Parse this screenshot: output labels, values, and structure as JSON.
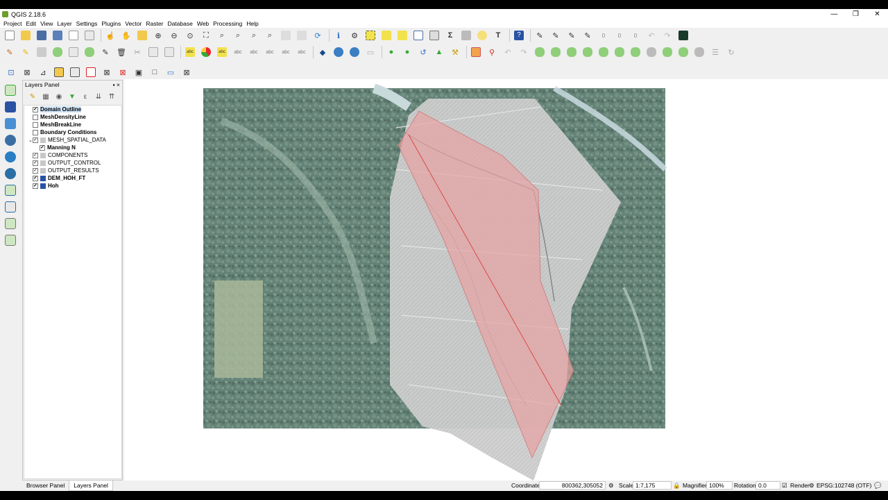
{
  "window": {
    "title": "QGIS 2.18.6",
    "controls": [
      "—",
      "❐",
      "✕"
    ]
  },
  "menu": [
    "Project",
    "Edit",
    "View",
    "Layer",
    "Settings",
    "Plugins",
    "Vector",
    "Raster",
    "Database",
    "Web",
    "Processing",
    "Help"
  ],
  "layers_panel": {
    "title": "Layers Panel",
    "header_controls": "▪ ×",
    "layers": [
      {
        "label": "Domain Outline",
        "checked": true,
        "bold": true,
        "selected": true,
        "indent": 0,
        "expander": ""
      },
      {
        "label": "MeshDensityLine",
        "checked": false,
        "bold": true,
        "indent": 0,
        "expander": ""
      },
      {
        "label": "MeshBreakLine",
        "checked": false,
        "bold": true,
        "indent": 0,
        "expander": ""
      },
      {
        "label": "Boundary Conditions",
        "checked": false,
        "bold": true,
        "indent": 0,
        "expander": ""
      },
      {
        "label": "MESH_SPATIAL_DATA",
        "checked": true,
        "bold": false,
        "indent": 0,
        "expander": "⌄",
        "group": true
      },
      {
        "label": "Manning N",
        "checked": true,
        "bold": true,
        "indent": 1,
        "expander": ""
      },
      {
        "label": "COMPONENTS",
        "checked": true,
        "bold": false,
        "indent": 0,
        "expander": "",
        "group": true
      },
      {
        "label": "OUTPUT_CONTROL",
        "checked": true,
        "bold": false,
        "indent": 0,
        "expander": "",
        "group": true
      },
      {
        "label": "OUTPUT_RESULTS",
        "checked": true,
        "bold": false,
        "indent": 0,
        "expander": "",
        "group": true
      },
      {
        "label": "DEM_HOH_FT",
        "checked": true,
        "bold": true,
        "indent": 0,
        "expander": "",
        "raster": true
      },
      {
        "label": "Hoh",
        "checked": true,
        "bold": true,
        "indent": 0,
        "expander": "",
        "raster": true
      }
    ]
  },
  "bottom_tabs": [
    {
      "label": "Browser Panel",
      "active": false
    },
    {
      "label": "Layers Panel",
      "active": true
    }
  ],
  "status": {
    "coordinate_label": "Coordinate",
    "coordinate_value": "800362,305052",
    "scale_label": "Scale",
    "scale_value": "1:7,175",
    "magnifier_label": "Magnifier",
    "magnifier_value": "100%",
    "rotation_label": "Rotation",
    "rotation_value": "0.0",
    "render_label": "Render",
    "crs": "EPSG:102748 (OTF)"
  },
  "toolbar_counters": [
    "0",
    "0",
    "0"
  ],
  "colors": {
    "accent_green": "#6a9f2c",
    "selection": "#cde3f7",
    "domain_fill": "#e8a2a2",
    "mesh_fill": "#d0d0d0"
  }
}
